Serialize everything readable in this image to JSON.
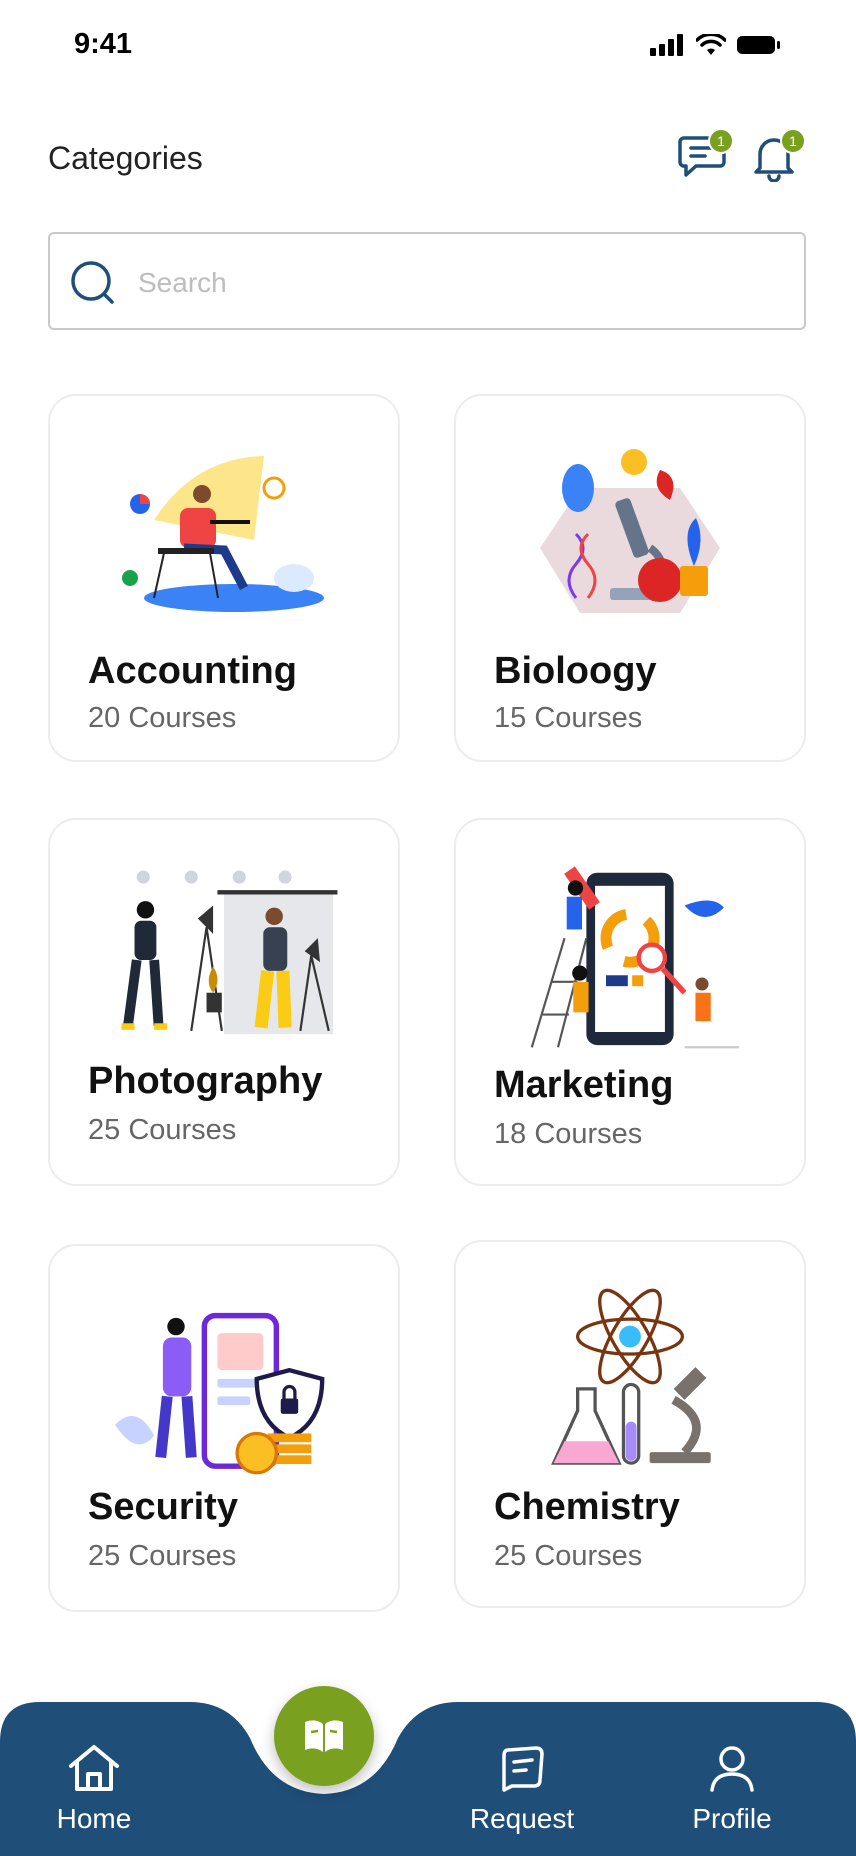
{
  "status": {
    "time": "9:41"
  },
  "header": {
    "title": "Categories",
    "messages_badge": "1",
    "notifications_badge": "1"
  },
  "search": {
    "placeholder": "Search"
  },
  "categories": [
    {
      "title": "Accounting",
      "count": "20 Courses"
    },
    {
      "title": "Bioloogy",
      "count": "15 Courses"
    },
    {
      "title": "Photography",
      "count": "25 Courses"
    },
    {
      "title": "Marketing",
      "count": "18 Courses"
    },
    {
      "title": "Security",
      "count": "25 Courses"
    },
    {
      "title": "Chemistry",
      "count": "25 Courses"
    }
  ],
  "nav": {
    "home": "Home",
    "request": "Request",
    "profile": "Profile"
  },
  "colors": {
    "primary": "#1f4e79",
    "accent": "#7aa01f"
  }
}
